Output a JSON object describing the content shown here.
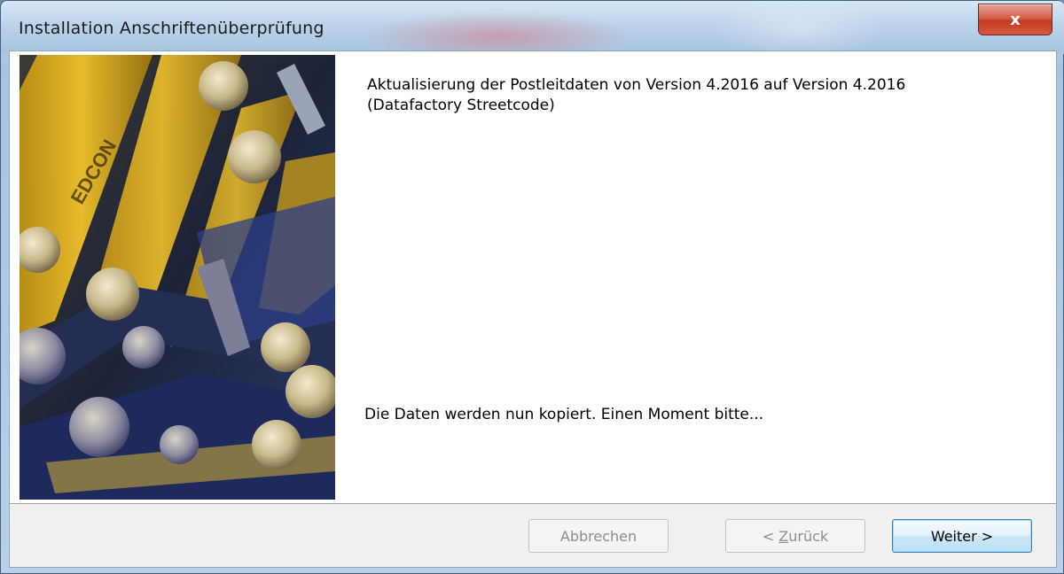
{
  "window": {
    "title": "Installation Anschriftenüberprüfung",
    "close_label": "x"
  },
  "main": {
    "heading": "Aktualisierung der Postleitdaten von Version 4.2016 auf Version 4.2016 (Datafactory Streetcode)",
    "status": "Die Daten werden nun kopiert. Einen Moment bitte..."
  },
  "image": {
    "brand_text": "EDCON"
  },
  "buttons": {
    "cancel": "Abbrechen",
    "back_prefix": "< ",
    "back_mnemonic": "Z",
    "back_rest": "urück",
    "next": "Weiter >"
  },
  "colors": {
    "accent": "#3c7fb1",
    "close": "#c23b22"
  }
}
